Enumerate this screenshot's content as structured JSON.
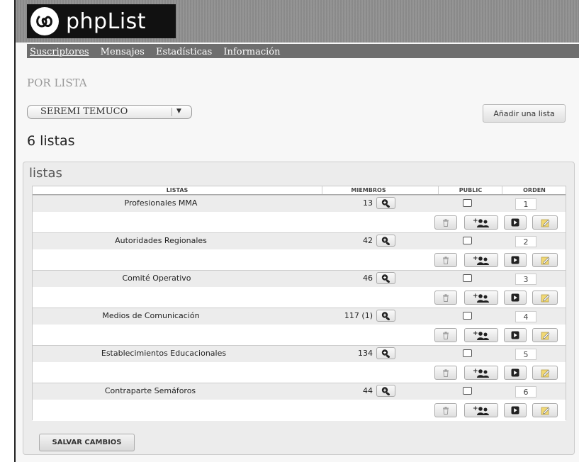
{
  "app": {
    "logo_text": "phpList"
  },
  "nav": {
    "items": [
      {
        "label": "Suscriptores"
      },
      {
        "label": "Mensajes"
      },
      {
        "label": "Estadísticas"
      },
      {
        "label": "Información"
      }
    ]
  },
  "page": {
    "title": "POR LISTA",
    "count_text": "6 listas"
  },
  "owner_select": {
    "value": "SEREMI TEMUCO"
  },
  "add_list_button": {
    "label": "Añadir una lista"
  },
  "panel": {
    "title": "listas"
  },
  "table": {
    "headers": {
      "listas": "LISTAS",
      "miembros": "MIEMBROS",
      "public": "PUBLIC",
      "orden": "ORDEN"
    },
    "rows": [
      {
        "name": "Profesionales MMA",
        "members": "13",
        "order": "1",
        "public": false
      },
      {
        "name": "Autoridades Regionales",
        "members": "42",
        "order": "2",
        "public": false
      },
      {
        "name": "Comité Operativo",
        "members": "46",
        "order": "3",
        "public": false
      },
      {
        "name": "Medios de Comunicación",
        "members": "117 (1)",
        "order": "4",
        "public": false
      },
      {
        "name": "Establecimientos Educacionales",
        "members": "134",
        "order": "5",
        "public": false
      },
      {
        "name": "Contraparte Semáforos",
        "members": "44",
        "order": "6",
        "public": false
      }
    ]
  },
  "save_button": {
    "label": "SALVAR CAMBIOS"
  },
  "icons": [
    "phplist-logo-icon",
    "zoom-icon",
    "trash-icon",
    "add-members-icon",
    "send-icon",
    "edit-icon"
  ],
  "colors": {
    "header_bg": "#8f8f8f",
    "nav_bg": "#6e6e6e",
    "logo_bg": "#111111",
    "row_bg": "#ececec"
  }
}
